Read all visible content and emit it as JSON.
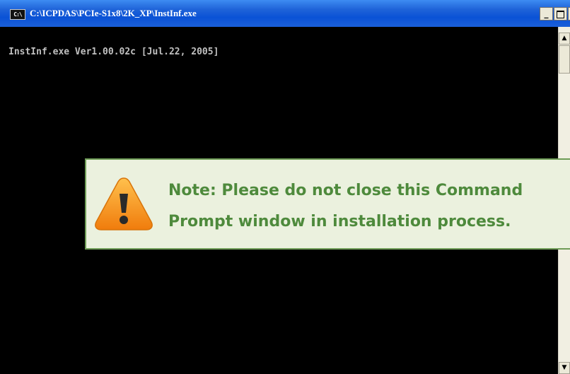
{
  "window": {
    "icon_name": "cmd-icon",
    "icon_text": "C:\\",
    "title": "C:\\ICPDAS\\PCIe-S1x8\\2K_XP\\InstInf.exe",
    "buttons": {
      "minimize": "_",
      "close": "×"
    }
  },
  "console": {
    "lines": [
      "InstInf.exe Ver1.00.02c [Jul.22, 2005]"
    ]
  },
  "scrollbar": {
    "up_arrow": "▲",
    "down_arrow": "▼"
  },
  "note": {
    "icon_name": "warning-icon",
    "line1": "Note: Please do not close this Command",
    "line2": "Prompt window in installation process.",
    "colors": {
      "text": "#4e8a3c",
      "background": "#ebf1de",
      "border": "#6e9c56",
      "icon": "#f7931e"
    }
  }
}
